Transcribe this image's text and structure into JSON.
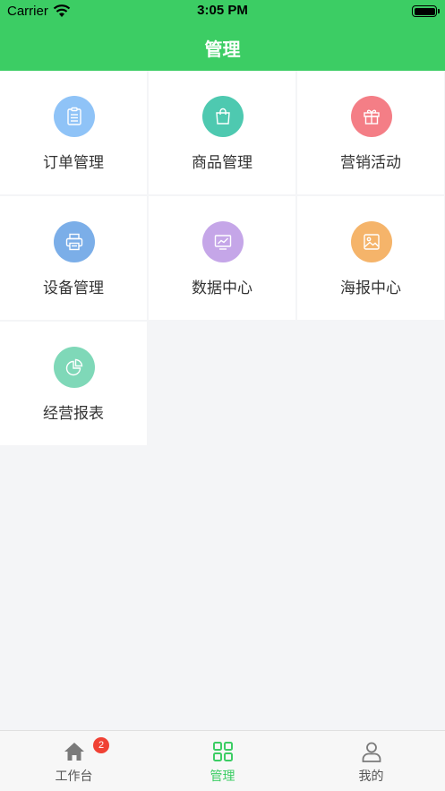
{
  "status_bar": {
    "carrier": "Carrier",
    "time": "3:05 PM"
  },
  "header": {
    "title": "管理"
  },
  "grid": {
    "items": [
      {
        "label": "订单管理",
        "icon": "clipboard-icon",
        "color": "#8fc3f7"
      },
      {
        "label": "商品管理",
        "icon": "shopping-bag-icon",
        "color": "#4ec9b0"
      },
      {
        "label": "营销活动",
        "icon": "gift-icon",
        "color": "#f47e86"
      },
      {
        "label": "设备管理",
        "icon": "printer-icon",
        "color": "#7baee8"
      },
      {
        "label": "数据中心",
        "icon": "monitor-chart-icon",
        "color": "#c5a6e8"
      },
      {
        "label": "海报中心",
        "icon": "image-icon",
        "color": "#f5b46a"
      },
      {
        "label": "经营报表",
        "icon": "pie-chart-icon",
        "color": "#7fd8b8"
      }
    ]
  },
  "tabbar": {
    "tabs": [
      {
        "label": "工作台",
        "icon": "home-icon",
        "badge": "2"
      },
      {
        "label": "管理",
        "icon": "grid-icon",
        "active": true
      },
      {
        "label": "我的",
        "icon": "user-icon"
      }
    ]
  },
  "colors": {
    "brand": "#3ccd64",
    "badge": "#f04134",
    "background": "#f4f5f7"
  }
}
